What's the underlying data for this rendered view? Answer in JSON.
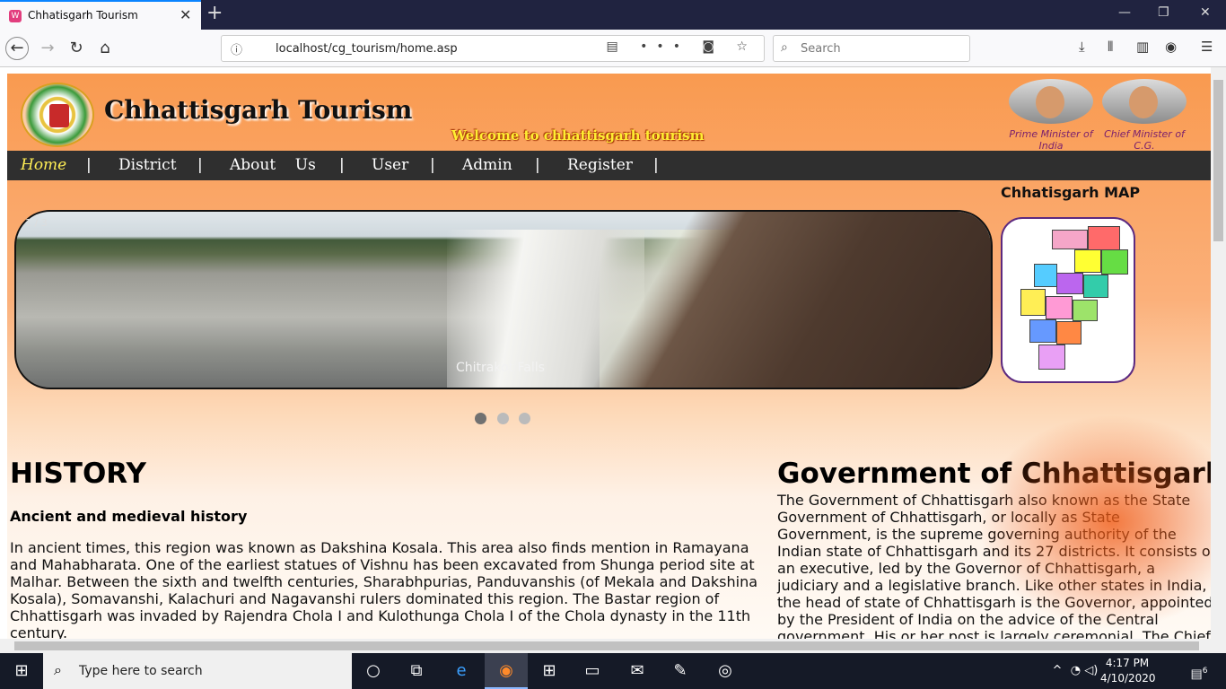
{
  "browser": {
    "tab_title": "Chhatisgarh Tourism",
    "url": "localhost/cg_tourism/home.asp",
    "search_placeholder": "Search"
  },
  "site": {
    "title": "Chhattisgarh Tourism",
    "welcome": "Welcome to chhattisgarh tourism",
    "leaders": [
      {
        "caption": "Prime Minister of India"
      },
      {
        "caption": "Chief Minister of C.G."
      }
    ],
    "menu": [
      "Home",
      "District",
      "About    Us",
      "User",
      "Admin",
      "Register"
    ],
    "slider": {
      "counter": "1 / 3",
      "caption": "Chitrakot Falls"
    },
    "map_title": "Chhatisgarh MAP",
    "history": {
      "heading": "HISTORY",
      "subheading": "Ancient and medieval history",
      "text": "In ancient times, this region was known as Dakshina Kosala. This area also finds mention in Ramayana and Mahabharata. One of the earliest statues of Vishnu has been excavated from Shunga period site at Malhar. Between the sixth and twelfth centuries, Sharabhpurias, Panduvanshis (of Mekala and Dakshina Kosala), Somavanshi, Kalachuri and Nagavanshi rulers dominated this region. The Bastar region of Chhattisgarh was invaded by Rajendra Chola I and Kulothunga Chola I of the Chola dynasty in the 11th century."
    },
    "government": {
      "heading": "Government of Chhattisgarh",
      "text": "The Government of Chhattisgarh also known as the State Government of Chhattisgarh, or locally as State Government, is the supreme governing authority of the Indian state of Chhattisgarh and its 27 districts. It consists of an executive, led by the Governor of Chhattisgarh, a judiciary and a legislative branch. Like other states in India, the head of state of Chhattisgarh is the Governor, appointed by the President of India on the advice of the Central government. His or her post is largely ceremonial. The Chief"
    }
  },
  "taskbar": {
    "search_placeholder": "Type here to search",
    "time": "4:17 PM",
    "date": "4/10/2020",
    "notification_count": "6"
  }
}
